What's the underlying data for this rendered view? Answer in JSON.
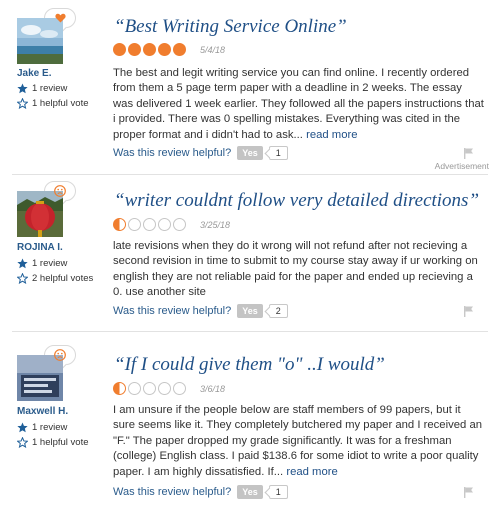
{
  "reviews": [
    {
      "user": "Jake E.",
      "reviews_count": "1 review",
      "helpful_votes": "1 helpful vote",
      "title": "“Best Writing Service Online”",
      "rating": 5,
      "date": "5/4/18",
      "text": "The best and legit writing service you can find online. I recently ordered from them a 5 page term paper with a deadline in 2 weeks. The essay was delivered 1 week earlier. They followed all the papers instructions that i provided. There was 0 spelling mistakes. Everything was cited in the proper format and i didn't had to ask...",
      "read_more": "read more",
      "helpful_label": "Was this review helpful?",
      "yes_label": "Yes",
      "yes_count": "1",
      "badge_icon": "heart-icon"
    },
    {
      "user": "ROJINA I.",
      "reviews_count": "1 review",
      "helpful_votes": "2 helpful votes",
      "title": "“writer couldnt follow very detailed directions”",
      "rating": 1,
      "date": "3/25/18",
      "text": "late revisions when they do it wrong will not refund after not recieving a second revision in time to submit to my course stay away if ur working on english they are not reliable paid for the paper and ended up recieving a 0. use another site",
      "read_more": "",
      "helpful_label": "Was this review helpful?",
      "yes_label": "Yes",
      "yes_count": "2",
      "badge_icon": "frown-face-icon"
    },
    {
      "user": "Maxwell H.",
      "reviews_count": "1 review",
      "helpful_votes": "1 helpful vote",
      "title": "“If I could give them \"o\" ..I would”",
      "rating": 1,
      "date": "3/6/18",
      "text": "I am unsure if the people below are staff members of 99 papers, but it sure seems like it. They completely butchered my paper and I received an \"F.\" The paper dropped my grade significantly. It was for a freshman (college) English class. I paid $138.6 for some idiot to write a poor quality paper. I am highly dissatisfied. If...",
      "read_more": "read more",
      "helpful_label": "Was this review helpful?",
      "yes_label": "Yes",
      "yes_count": "1",
      "badge_icon": "frown-face-icon"
    }
  ],
  "advertisement_label": "Advertisement",
  "colors": {
    "accent": "#f07d2e",
    "link": "#1f4f86",
    "user": "#2a5b8b"
  }
}
